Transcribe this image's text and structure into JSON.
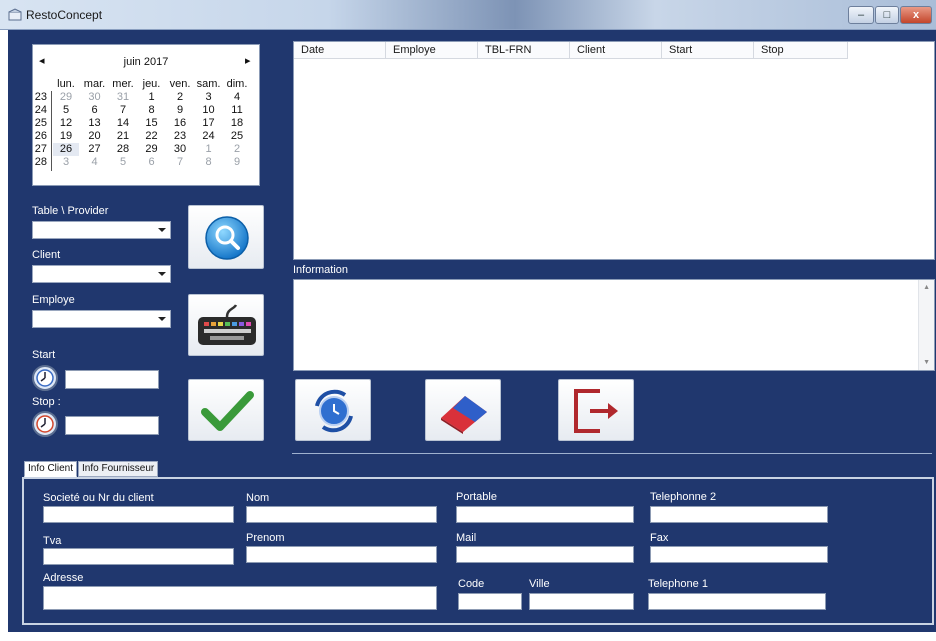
{
  "window": {
    "title": "RestoConcept",
    "controls": {
      "minimize": "–",
      "maximize": "□",
      "close": "x"
    }
  },
  "calendar": {
    "month_label": "juin 2017",
    "prev": "◂",
    "next": "▸",
    "day_headers": [
      "lun.",
      "mar.",
      "mer.",
      "jeu.",
      "ven.",
      "sam.",
      "dim."
    ],
    "weeks": [
      {
        "week": "23",
        "days": [
          "29",
          "30",
          "31",
          "1",
          "2",
          "3",
          "4"
        ]
      },
      {
        "week": "24",
        "days": [
          "5",
          "6",
          "7",
          "8",
          "9",
          "10",
          "11"
        ]
      },
      {
        "week": "25",
        "days": [
          "12",
          "13",
          "14",
          "15",
          "16",
          "17",
          "18"
        ]
      },
      {
        "week": "26",
        "days": [
          "19",
          "20",
          "21",
          "22",
          "23",
          "24",
          "25"
        ]
      },
      {
        "week": "27",
        "days": [
          "26",
          "27",
          "28",
          "29",
          "30",
          "1",
          "2"
        ]
      },
      {
        "week": "28",
        "days": [
          "3",
          "4",
          "5",
          "6",
          "7",
          "8",
          "9"
        ]
      }
    ]
  },
  "filters": {
    "table_provider_label": "Table \\ Provider",
    "client_label": "Client",
    "employe_label": "Employe",
    "start_label": "Start",
    "stop_label": "Stop :"
  },
  "grid": {
    "columns": [
      "Date",
      "Employe",
      "TBL-FRN",
      "Client",
      "Start",
      "Stop"
    ]
  },
  "information": {
    "label": "Information",
    "scroll_up": "▲",
    "scroll_down": "▼"
  },
  "icons": {
    "search": "magnifier-icon",
    "keyboard": "keyboard-icon",
    "validate": "checkmark-icon",
    "refresh": "refresh-icon",
    "eraser": "eraser-icon",
    "exit": "exit-door-icon",
    "start_clock": "clock-icon",
    "stop_clock": "clock-stop-icon"
  },
  "tabs": [
    "Info Client",
    "Info Fournisseur"
  ],
  "client_form": {
    "societe_label": "Societé ou Nr du client",
    "nom_label": "Nom",
    "portable_label": "Portable",
    "telephone2_label": "Telephonne 2",
    "tva_label": "Tva",
    "prenom_label": "Prenom",
    "mail_label": "Mail",
    "fax_label": "Fax",
    "adresse_label": "Adresse",
    "code_label": "Code",
    "ville_label": "Ville",
    "telephone1_label": "Telephone 1"
  },
  "colors": {
    "background": "#20376e",
    "accent_green": "#3a9a3a",
    "exit_red": "#b0282d"
  }
}
